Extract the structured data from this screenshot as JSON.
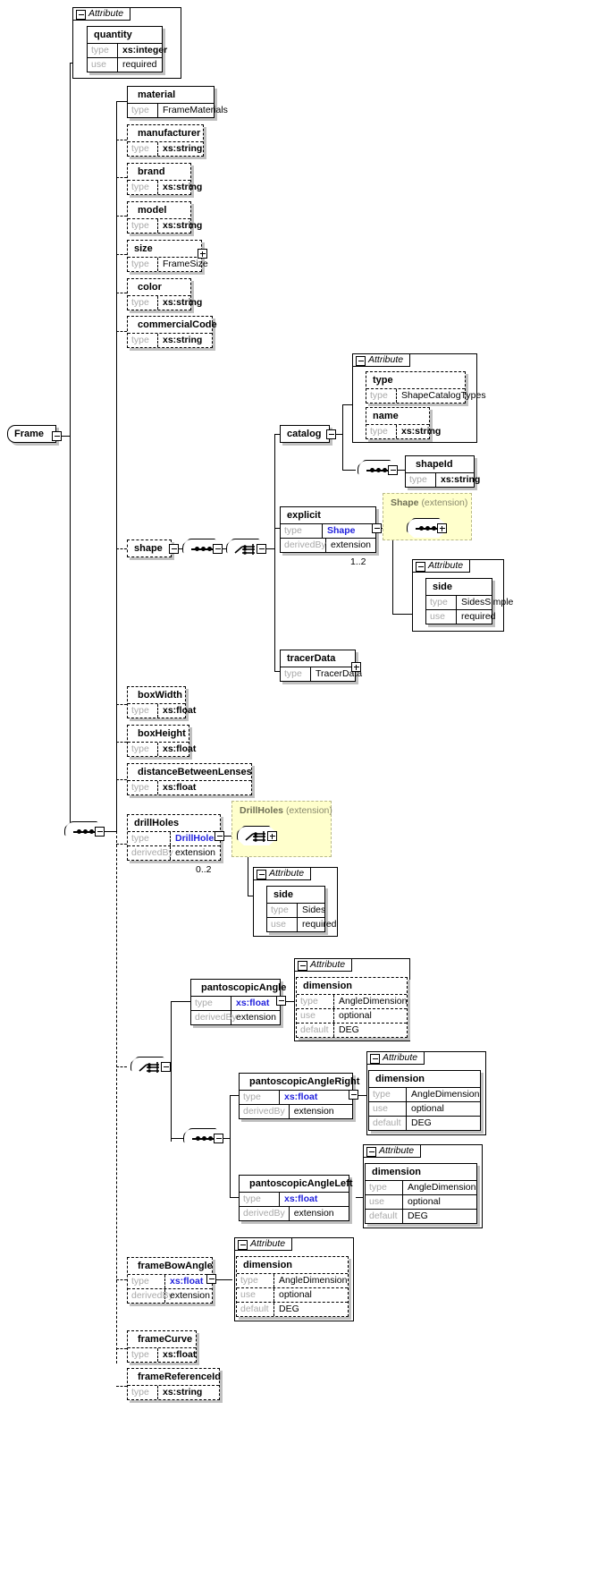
{
  "diagram": {
    "title": "Frame",
    "type": "xsd-schema-diagram",
    "root": {
      "name": "Frame",
      "kind": "element",
      "optional": false
    }
  },
  "labels": {
    "attribute_group": "Attribute",
    "type_key": "type",
    "use_key": "use",
    "default_key": "default",
    "derivedby_key": "derivedBy"
  },
  "attributes": {
    "quantity": {
      "name": "quantity",
      "type": "xs:integer",
      "use": "required",
      "optional": false
    },
    "catalog_type": {
      "name": "type",
      "type": "ShapeCatalogTypes",
      "optional": true
    },
    "catalog_name": {
      "name": "name",
      "type": "xs:string",
      "optional": true
    },
    "shape_side": {
      "name": "side",
      "type": "SidesSimple",
      "use": "required",
      "optional": false
    },
    "drill_side": {
      "name": "side",
      "type": "Sides",
      "use": "required",
      "optional": false
    },
    "panto_dimension": {
      "name": "dimension",
      "type": "AngleDimension",
      "use": "optional",
      "default": "DEG",
      "optional": true
    },
    "pantoR_dimension": {
      "name": "dimension",
      "type": "AngleDimension",
      "use": "optional",
      "default": "DEG",
      "optional": false
    },
    "pantoL_dimension": {
      "name": "dimension",
      "type": "AngleDimension",
      "use": "optional",
      "default": "DEG",
      "optional": false
    },
    "bow_dimension": {
      "name": "dimension",
      "type": "AngleDimension",
      "use": "optional",
      "default": "DEG",
      "optional": true
    }
  },
  "elements": {
    "material": {
      "name": "material",
      "type": "FrameMaterials",
      "optional": false
    },
    "manufacturer": {
      "name": "manufacturer",
      "type": "xs:string",
      "optional": true
    },
    "brand": {
      "name": "brand",
      "type": "xs:string",
      "optional": true
    },
    "model": {
      "name": "model",
      "type": "xs:string",
      "optional": true
    },
    "size": {
      "name": "size",
      "type": "FrameSize",
      "optional": true,
      "expandable": true
    },
    "color": {
      "name": "color",
      "type": "xs:string",
      "optional": true
    },
    "commercialCode": {
      "name": "commercialCode",
      "type": "xs:string",
      "optional": true
    },
    "shape": {
      "name": "shape",
      "optional": true
    },
    "catalog": {
      "name": "catalog",
      "optional": false
    },
    "shapeId": {
      "name": "shapeId",
      "type": "xs:string",
      "optional": false
    },
    "explicit": {
      "name": "explicit",
      "type": "Shape",
      "derivedBy": "extension",
      "optional": false,
      "cardinality": "1..2"
    },
    "tracerData": {
      "name": "tracerData",
      "type": "TracerData",
      "optional": false,
      "expandable": true
    },
    "boxWidth": {
      "name": "boxWidth",
      "type": "xs:float",
      "optional": true
    },
    "boxHeight": {
      "name": "boxHeight",
      "type": "xs:float",
      "optional": true
    },
    "distanceBetweenLenses": {
      "name": "distanceBetweenLenses",
      "type": "xs:float",
      "optional": true
    },
    "drillHoles": {
      "name": "drillHoles",
      "type": "DrillHoles",
      "derivedBy": "extension",
      "optional": true,
      "cardinality": "0..2"
    },
    "pantoscopicAngle": {
      "name": "pantoscopicAngle",
      "type": "xs:float",
      "derivedBy": "extension",
      "optional": false
    },
    "pantoscopicAngleRight": {
      "name": "pantoscopicAngleRight",
      "type": "xs:float",
      "derivedBy": "extension",
      "optional": false
    },
    "pantoscopicAngleLeft": {
      "name": "pantoscopicAngleLeft",
      "type": "xs:float",
      "derivedBy": "extension",
      "optional": false
    },
    "frameBowAngle": {
      "name": "frameBowAngle",
      "type": "xs:float",
      "derivedBy": "extension",
      "optional": true
    },
    "frameCurve": {
      "name": "frameCurve",
      "type": "xs:float",
      "optional": true
    },
    "frameReferenceId": {
      "name": "frameReferenceId",
      "type": "xs:string",
      "optional": true
    }
  },
  "extensions": {
    "shape_ext": {
      "base": "Shape",
      "suffix": "(extension)"
    },
    "drillholes_ext": {
      "base": "DrillHoles",
      "suffix": "(extension)"
    }
  },
  "colors": {
    "extension_bg": "#ffffcc",
    "extension_border": "#b9b98a",
    "link_text": "#2222dd",
    "key_text": "#a9a9a9",
    "line": "#000000",
    "shadow": "#c0c0c0"
  }
}
